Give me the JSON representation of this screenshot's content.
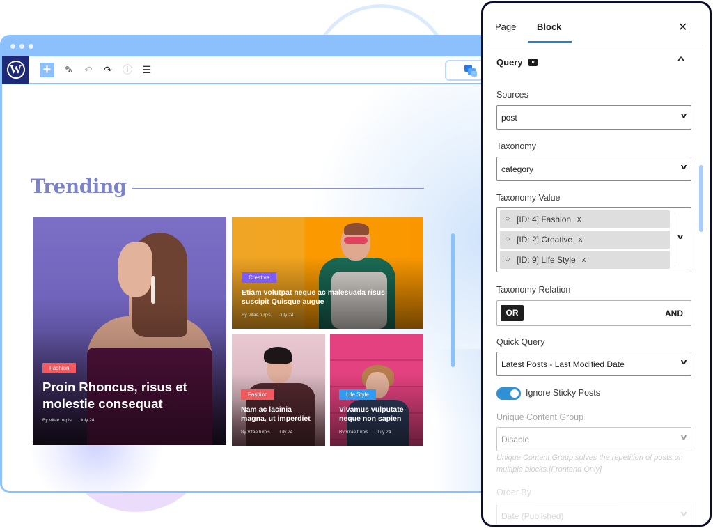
{
  "editor": {
    "toolbar": {
      "logo": "W",
      "add_label": "+",
      "icons": [
        "pencil-icon",
        "undo-icon",
        "redo-icon",
        "info-icon",
        "list-view-icon"
      ],
      "icon_glyphs": [
        "✎",
        "↶",
        "↷",
        "ⓘ",
        "☰"
      ]
    },
    "section_title": "Trending",
    "posts": [
      {
        "category": "Fashion",
        "category_color": "#f05a5f",
        "title": "Proin Rhoncus, risus et molestie consequat",
        "author": "By Vitae turpis",
        "date": "July 24"
      },
      {
        "category": "Creative",
        "category_color": "#7d5cf6",
        "title": "Etiam volutpat neque ac malesuada risus suscipit Quisque augue",
        "author": "By Vitae turpis",
        "date": "July 24"
      },
      {
        "category": "Fashion",
        "category_color": "#f05a5f",
        "title": "Nam ac lacinia magna, ut imperdiet",
        "author": "By Vitae turpis",
        "date": "July 24"
      },
      {
        "category": "Life Style",
        "category_color": "#2f9cf4",
        "title": "Vivamus vulputate neque non sapien",
        "author": "By Vitae turpis",
        "date": "July 24"
      }
    ]
  },
  "panel": {
    "tabs": [
      {
        "label": "Page",
        "active": false
      },
      {
        "label": "Block",
        "active": true
      }
    ],
    "close_label": "✕",
    "section_title": "Query",
    "section_chevron": "^",
    "sources": {
      "label": "Sources",
      "value": "post"
    },
    "taxonomy": {
      "label": "Taxonomy",
      "value": "category"
    },
    "taxonomy_value": {
      "label": "Taxonomy Value",
      "tags": [
        "[ID: 4] Fashion",
        "[ID: 2] Creative",
        "[ID: 9] Life Style"
      ],
      "remove_glyph": "x"
    },
    "taxonomy_relation": {
      "label": "Taxonomy Relation",
      "options": [
        "OR",
        "AND"
      ],
      "selected": "OR"
    },
    "quick_query": {
      "label": "Quick Query",
      "value": "Latest Posts - Last Modified Date"
    },
    "ignore_sticky": {
      "label": "Ignore Sticky Posts",
      "enabled": true
    },
    "unique_content_group": {
      "label": "Unique Content Group",
      "value": "Disable",
      "help": "Unique Content Group solves the repetition of posts on multiple blocks.[Frontend Only]"
    },
    "order_by": {
      "label": "Order By",
      "value": "Date (Published)"
    },
    "chevron_glyph": "v"
  }
}
